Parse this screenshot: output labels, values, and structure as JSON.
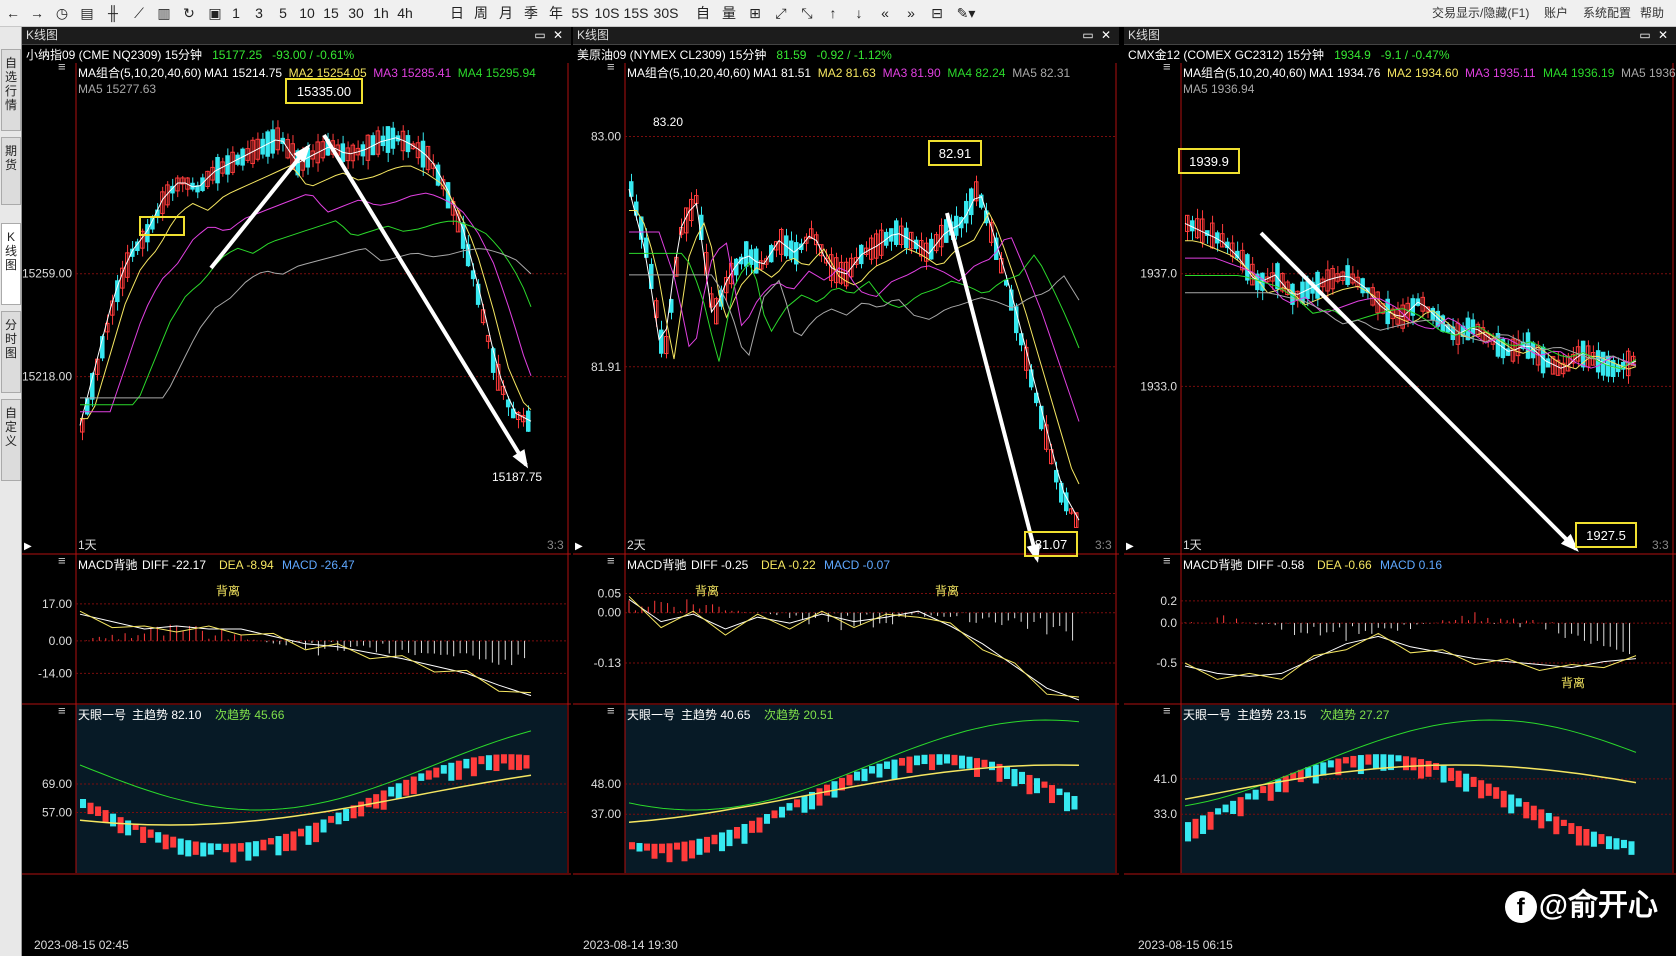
{
  "colors": {
    "up": "#ff3b3b",
    "down": "#36e8f0",
    "ma1": "#ffffff",
    "ma2": "#f5e661",
    "ma3": "#e040e0",
    "ma4": "#2bd92b",
    "ma5": "#a8a8a8",
    "grid": "#7a0d0d",
    "callout": "#f0e030",
    "diff": "#ffffff",
    "dea": "#f5e661"
  },
  "toolbar": {
    "icons": [
      "arrow-left-icon",
      "arrow-right-icon",
      "clock-icon",
      "calendar-grid-icon",
      "candlestick-icon",
      "line-chart-icon",
      "bar-icon",
      "redo-icon",
      "save-icon"
    ],
    "periods": [
      "1",
      "3",
      "5",
      "10",
      "15",
      "30",
      "1h",
      "4h",
      "日",
      "周",
      "月",
      "季",
      "年",
      "5S",
      "10S",
      "15S",
      "30S",
      "自",
      "量"
    ],
    "tools": [
      "grid-icon",
      "expand-icon",
      "shrink-icon",
      "arrow-up-icon",
      "arrow-down-icon",
      "double-left-icon",
      "double-right-icon",
      "layout-icon",
      "pen-icon"
    ],
    "right_links": [
      "交易显示/隐藏(F1)",
      "账户",
      "系统配置",
      "帮助"
    ]
  },
  "sidebar": {
    "tabs": [
      "自选行情",
      "期货",
      "K线图",
      "分时图",
      "自定义"
    ]
  },
  "panels": [
    {
      "window_title": "K线图",
      "symbol": "小纳指09 (CME NQ2309) 15分钟",
      "last": "15177.25",
      "change": "-93.00 / -0.61%",
      "ma_title": "MA组合(5,10,20,40,60)",
      "ma": [
        {
          "label": "MA1",
          "value": "15214.75"
        },
        {
          "label": "MA2",
          "value": "15254.05"
        },
        {
          "label": "MA3",
          "value": "15285.41"
        },
        {
          "label": "MA4",
          "value": "15295.94"
        },
        {
          "label": "MA5",
          "value": "15277.63"
        }
      ],
      "price_ticks": [
        "15259.00",
        "15218.00"
      ],
      "period": "1天",
      "corner": "3:3",
      "callouts": [
        "15335.00"
      ],
      "labels": [
        "15187.75"
      ],
      "macd": {
        "title": "MACD背驰",
        "diff": "DIFF -22.17",
        "dea": "DEA -8.94",
        "macd": "MACD -26.47",
        "ticks": [
          "17.00",
          "0.00",
          "-14.00"
        ],
        "tags": [
          "背离"
        ]
      },
      "ind": {
        "title": "天眼一号",
        "main": "主趋势 82.10",
        "sub": "次趋势 45.66",
        "ticks": [
          "69.00",
          "57.00"
        ]
      },
      "date": "2023-08-15 02:45"
    },
    {
      "window_title": "K线图",
      "symbol": "美原油09 (NYMEX CL2309) 15分钟",
      "last": "81.59",
      "change": "-0.92 / -1.12%",
      "ma_title": "MA组合(5,10,20,40,60)",
      "ma": [
        {
          "label": "MA1",
          "value": "81.51"
        },
        {
          "label": "MA2",
          "value": "81.63"
        },
        {
          "label": "MA3",
          "value": "81.90"
        },
        {
          "label": "MA4",
          "value": "82.24"
        },
        {
          "label": "MA5",
          "value": "82.31"
        }
      ],
      "price_ticks": [
        "83.00",
        "81.91"
      ],
      "period": "2天",
      "corner": "3:3",
      "callouts": [
        "82.91",
        "81.07"
      ],
      "labels": [
        "83.20"
      ],
      "macd": {
        "title": "MACD背驰",
        "diff": "DIFF -0.25",
        "dea": "DEA -0.22",
        "macd": "MACD -0.07",
        "ticks": [
          "0.05",
          "0.00",
          "-0.13"
        ],
        "tags": [
          "背离",
          "背离"
        ]
      },
      "ind": {
        "title": "天眼一号",
        "main": "主趋势 40.65",
        "sub": "次趋势 20.51",
        "ticks": [
          "48.00",
          "37.00"
        ]
      },
      "date": "2023-08-14 19:30"
    },
    {
      "window_title": "K线图",
      "symbol": "CMX金12 (COMEX GC2312) 15分钟",
      "last": "1934.9",
      "change": "-9.1 / -0.47%",
      "ma_title": "MA组合(5,10,20,40,60)",
      "ma": [
        {
          "label": "MA1",
          "value": "1934.76"
        },
        {
          "label": "MA2",
          "value": "1934.60"
        },
        {
          "label": "MA3",
          "value": "1935.11"
        },
        {
          "label": "MA4",
          "value": "1936.19"
        },
        {
          "label": "MA5",
          "value": "1936.94"
        }
      ],
      "price_ticks": [
        "1937.0",
        "1933.0"
      ],
      "period": "1天",
      "corner": "3:3",
      "callouts": [
        "1939.9",
        "1927.5"
      ],
      "labels": [],
      "macd": {
        "title": "MACD背驰",
        "diff": "DIFF -0.58",
        "dea": "DEA -0.66",
        "macd": "MACD 0.16",
        "ticks": [
          "0.2",
          "0.0",
          "-0.5"
        ],
        "tags": [
          "背离"
        ]
      },
      "ind": {
        "title": "天眼一号",
        "main": "主趋势 23.15",
        "sub": "次趋势 27.27",
        "ticks": [
          "41.0",
          "33.0"
        ]
      },
      "date": "2023-08-15 06:15"
    }
  ],
  "watermark": {
    "logo": "f",
    "text": "@俞开心"
  }
}
